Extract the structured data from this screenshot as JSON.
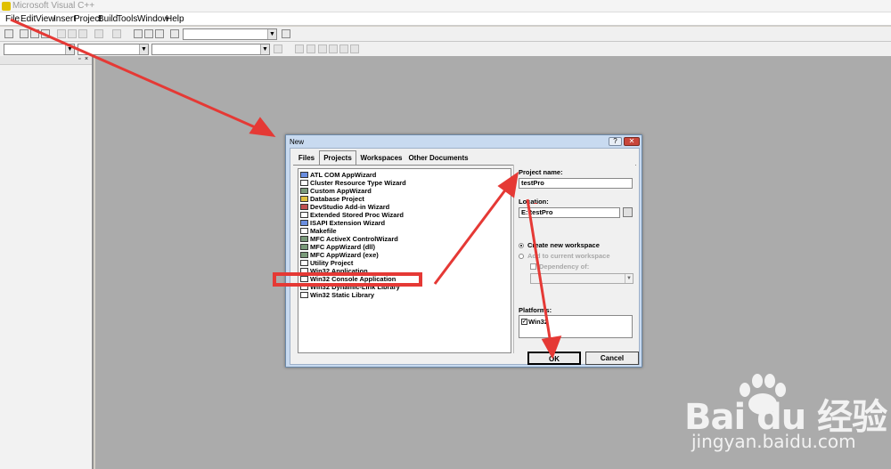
{
  "app": {
    "title": "Microsoft Visual C++"
  },
  "menu": [
    "File",
    "Edit",
    "View",
    "Insert",
    "Project",
    "Build",
    "Tools",
    "Window",
    "Help"
  ],
  "dialog": {
    "title": "New",
    "help": "?",
    "close": "✕",
    "tabs": [
      "Files",
      "Projects",
      "Workspaces",
      "Other Documents"
    ],
    "selected_tab": "Projects",
    "project_types": [
      "ATL COM AppWizard",
      "Cluster Resource Type Wizard",
      "Custom AppWizard",
      "Database Project",
      "DevStudio Add-in Wizard",
      "Extended Stored Proc Wizard",
      "ISAPI Extension Wizard",
      "Makefile",
      "MFC ActiveX ControlWizard",
      "MFC AppWizard (dll)",
      "MFC AppWizard (exe)",
      "Utility Project",
      "Win32 Application",
      "Win32 Console Application",
      "Win32 Dynamic-Link Library",
      "Win32 Static Library"
    ],
    "selected_type": "Win32 Console Application",
    "project_name_label": "Project name:",
    "project_name": "testPro",
    "location_label": "Location:",
    "location": "E:\\testPro",
    "create_new_workspace": "Create new workspace",
    "add_to_workspace": "Add to current workspace",
    "dependency_of": "Dependency of:",
    "platforms_label": "Platforms:",
    "platform": "Win32",
    "ok": "OK",
    "cancel": "Cancel"
  },
  "watermark": {
    "logo": "Bai du 经验",
    "url": "jingyan.baidu.com"
  },
  "annotation_color": "#e53935"
}
